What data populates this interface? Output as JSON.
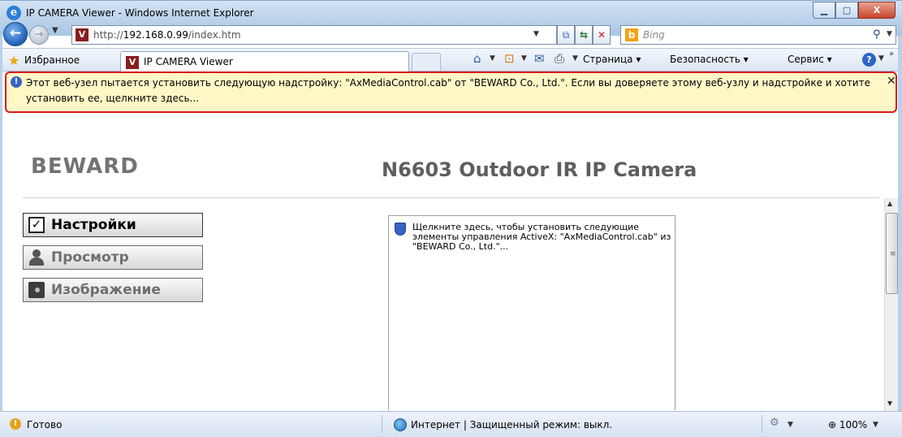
{
  "window": {
    "title": "IP CAMERA Viewer - Windows Internet Explorer",
    "min_glyph": "▁",
    "max_glyph": "▢",
    "close_glyph": "X"
  },
  "address_bar": {
    "url_prefix": "http://",
    "url_host": "192.168.0.99",
    "url_path": "/index.htm",
    "search_placeholder": "Bing"
  },
  "favorites_bar": {
    "favorites_label": "Избранное",
    "tab_title": "IP CAMERA Viewer",
    "page_menu": "Страница",
    "safety_menu": "Безопасность",
    "tools_menu": "Сервис"
  },
  "info_bar": {
    "message": "Этот веб-узел пытается установить следующую надстройку: \"AxMediaControl.cab\" от \"BEWARD Co., Ltd.\". Если вы доверяете этому веб-узлу и надстройке и хотите установить ее, щелкните здесь...",
    "close_glyph": "✕"
  },
  "page": {
    "logo": "BEWARD",
    "camera_title": "N6603 Outdoor IR IP Camera",
    "sidebar": [
      {
        "label": "Настройки",
        "icon": "checkbox-icon"
      },
      {
        "label": "Просмотр",
        "icon": "user-icon"
      },
      {
        "label": "Изображение",
        "icon": "camera-icon"
      }
    ],
    "activex_prompt": "Щелкните здесь, чтобы установить следующие элементы управления ActiveX: \"AxMediaControl.cab\" из \"BEWARD Co., Ltd.\"..."
  },
  "status_bar": {
    "status": "Готово",
    "zone": "Интернет | Защищенный режим: выкл.",
    "zoom": "100%"
  },
  "colors": {
    "info_bar_bg": "#fff8c6",
    "info_bar_highlight": "#d71b1b",
    "chrome_blue": "#b9d1ea"
  }
}
